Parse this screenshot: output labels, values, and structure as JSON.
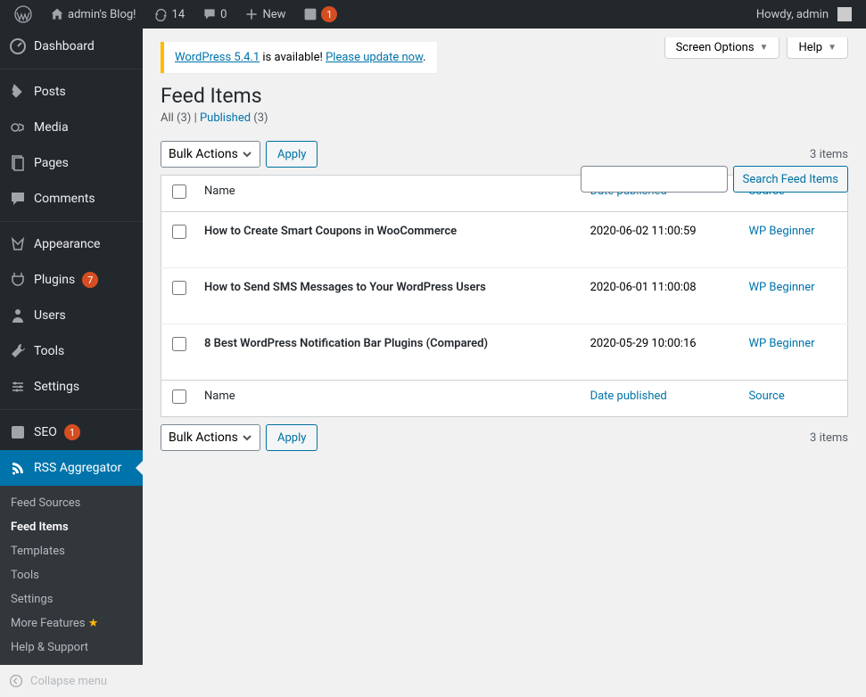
{
  "adminbar": {
    "site_name": "admin's Blog!",
    "updates_count": "14",
    "comments_count": "0",
    "new_label": "New",
    "seo_notice_count": "1",
    "greeting": "Howdy, admin"
  },
  "sidebar": {
    "dashboard": "Dashboard",
    "posts": "Posts",
    "media": "Media",
    "pages": "Pages",
    "comments": "Comments",
    "appearance": "Appearance",
    "plugins": "Plugins",
    "plugins_count": "7",
    "users": "Users",
    "tools": "Tools",
    "settings": "Settings",
    "seo": "SEO",
    "seo_count": "1",
    "rss_aggregator": "RSS Aggregator",
    "submenu": {
      "feed_sources": "Feed Sources",
      "feed_items": "Feed Items",
      "templates": "Templates",
      "tools": "Tools",
      "settings": "Settings",
      "more_features": "More Features",
      "help_support": "Help & Support"
    },
    "collapse": "Collapse menu"
  },
  "screen_options": "Screen Options",
  "help_label": "Help",
  "notice": {
    "link1": "WordPress 5.4.1",
    "mid": " is available! ",
    "link2": "Please update now",
    "punct": "."
  },
  "page_title": "Feed Items",
  "filters": {
    "all_label": "All",
    "all_count": "(3)",
    "divider": " | ",
    "published_label": "Published",
    "published_count": "(3)"
  },
  "search": {
    "button": "Search Feed Items"
  },
  "bulk_actions": {
    "label": "Bulk Actions",
    "apply": "Apply"
  },
  "items_count_label": "3 items",
  "columns": {
    "name": "Name",
    "date_published": "Date published",
    "source": "Source"
  },
  "rows": [
    {
      "title": "How to Create Smart Coupons in WooCommerce",
      "date": "2020-06-02 11:00:59",
      "source": "WP Beginner"
    },
    {
      "title": "How to Send SMS Messages to Your WordPress Users",
      "date": "2020-06-01 11:00:08",
      "source": "WP Beginner"
    },
    {
      "title": "8 Best WordPress Notification Bar Plugins (Compared)",
      "date": "2020-05-29 10:00:16",
      "source": "WP Beginner"
    }
  ]
}
